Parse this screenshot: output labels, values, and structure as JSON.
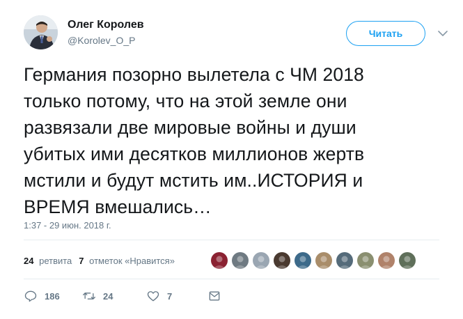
{
  "author": {
    "name": "Олег Королев",
    "handle": "@Korolev_O_P"
  },
  "follow_button_label": "Читать",
  "tweet": {
    "text": "Германия позорно вылетела с ЧМ 2018\nтолько потому, что на этой земле они\nразвязали две мировые войны и души\nубитых ими десятков миллионов жертв\nмстили и будут мстить им..ИСТОРИЯ и\nВРЕМЯ вмешались…",
    "timestamp": "1:37 - 29 июн. 2018 г."
  },
  "stats": {
    "retweets_count": "24",
    "retweets_label": "ретвита",
    "likes_count": "7",
    "likes_label": "отметок «Нравится»"
  },
  "likers": [
    {
      "color": "#8b2232"
    },
    {
      "color": "#6f7a82"
    },
    {
      "color": "#9aa6b2"
    },
    {
      "color": "#4a3a30"
    },
    {
      "color": "#3d6a8a"
    },
    {
      "color": "#a98d6a"
    },
    {
      "color": "#556b7a"
    },
    {
      "color": "#8a8f70"
    },
    {
      "color": "#b0826a"
    },
    {
      "color": "#5f6f5a"
    }
  ],
  "actions": {
    "reply_count": "186",
    "retweet_count": "24",
    "like_count": "7"
  },
  "colors": {
    "accent": "#1da1f2",
    "secondary_text": "#657786",
    "primary_text": "#14171a",
    "divider": "#e6ecf0"
  },
  "icons": [
    "reply-icon",
    "retweet-icon",
    "heart-icon",
    "direct-message-icon",
    "chevron-down-icon"
  ]
}
